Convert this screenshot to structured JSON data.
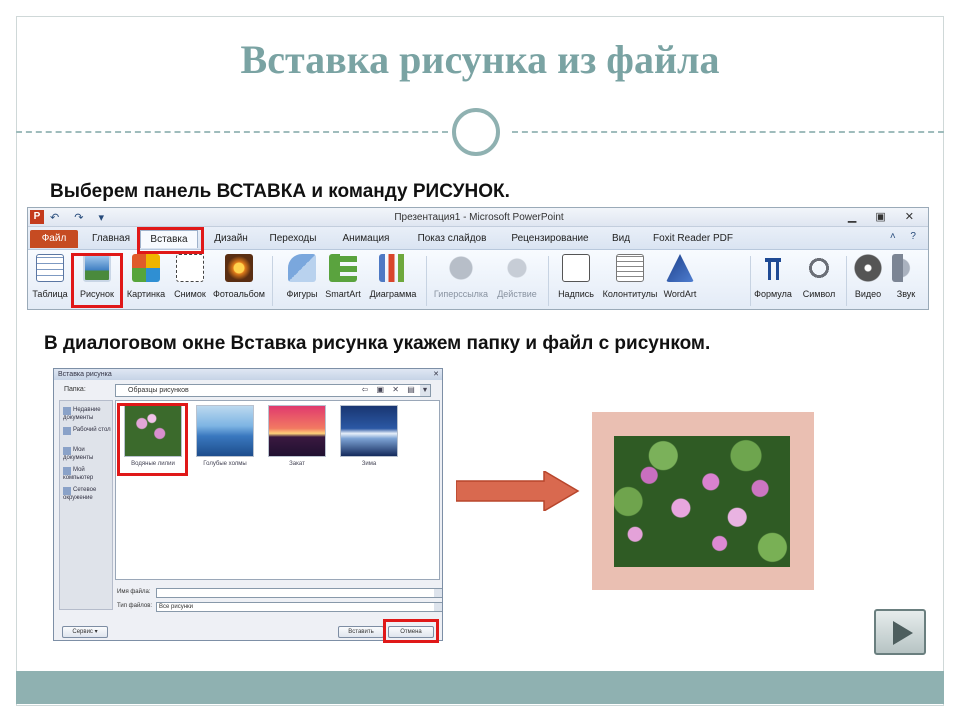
{
  "slide": {
    "title": "Вставка рисунка из файла",
    "instruction_1": "Выберем  панель ВСТАВКА и команду РИСУНОК.",
    "instruction_2": "В диалоговом окне Вставка рисунка укажем папку и файл с рисунком."
  },
  "ribbon": {
    "window_title": "Презентация1 - Microsoft PowerPoint",
    "app_logo": "P",
    "quick_access": "↶ ↷ ▾",
    "window_controls": "▁ ▣ ✕",
    "tab_controls": "˄ ?",
    "tabs": [
      "Файл",
      "Главная",
      "Вставка",
      "Дизайн",
      "Переходы",
      "Анимация",
      "Показ слайдов",
      "Рецензирование",
      "Вид",
      "Foxit Reader PDF"
    ],
    "active_tab": "Вставка",
    "commands": [
      "Таблица",
      "Рисунок",
      "Картинка",
      "Снимок",
      "Фотоальбом",
      "Фигуры",
      "SmartArt",
      "Диаграмма",
      "Гиперссылка",
      "Действие",
      "Надпись",
      "Колонтитулы",
      "WordArt",
      "Формула",
      "Символ",
      "Видео",
      "Звук"
    ],
    "highlighted_command": "Рисунок"
  },
  "dialog": {
    "title": "Вставка рисунка",
    "close_glyph": "✕",
    "look_in_label": "Папка:",
    "look_in_value": "Образцы рисунков",
    "toolbar_glyphs": "⇦ ▣ ✕ ▤ ▾",
    "places": [
      "Недавние документы",
      "Рабочий стол",
      "Мои документы",
      "Мой компьютер",
      "Сетевое окружение"
    ],
    "files": [
      "Водяные лилии",
      "Голубые холмы",
      "Закат",
      "Зима"
    ],
    "selected_file": "Водяные лилии",
    "filename_label": "Имя файла:",
    "filename_value": "",
    "filetype_label": "Тип файлов:",
    "filetype_value": "Все рисунки",
    "service_button": "Сервис ▾",
    "insert_button": "Вставить",
    "cancel_button": "Отмена"
  },
  "colors": {
    "title": "#7aa3a3",
    "accent_bar": "#8fb1b1",
    "highlight": "#e01818",
    "arrow": "#d9694f",
    "result_frame": "#eabfb2"
  },
  "icons": {
    "next_slide": "next-slide-icon"
  }
}
